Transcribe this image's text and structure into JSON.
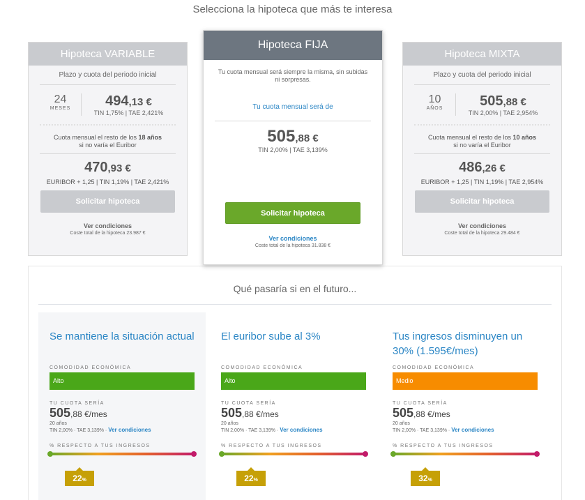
{
  "page": {
    "title": "Selecciona la hipoteca que más te interesa"
  },
  "cards": {
    "variable": {
      "title": "Hipoteca VARIABLE",
      "subtitle": "Plazo y cuota del periodo inicial",
      "months": "24",
      "months_unit": "MESES",
      "price_int": "494",
      "price_dec": ",13 €",
      "rates": "TIN 1,75% | TAE 2,421%",
      "note_pre": "Cuota mensual el resto de los",
      "note_years": "18 años",
      "note_post": "si no varía el Euribor",
      "price2_int": "470",
      "price2_dec": ",93 €",
      "rates2": "EURIBOR + 1,25 | TIN 1,19% | TAE 2,421%",
      "button": "Solicitar hipoteca",
      "conditions": "Ver condiciones",
      "cost": "Coste total de la hipoteca 23.987 €"
    },
    "fija": {
      "title": "Hipoteca FIJA",
      "description": "Tu cuota mensual será siempre la misma, sin subidas ni sorpresas.",
      "label": "Tu cuota mensual será de",
      "price_int": "505",
      "price_dec": ",88 €",
      "rates": "TIN 2,00% | TAE 3,139%",
      "button": "Solicitar hipoteca",
      "conditions": "Ver condiciones",
      "cost": "Coste total de la hipoteca 31.838 €"
    },
    "mixta": {
      "title": "Hipoteca MIXTA",
      "subtitle": "Plazo y cuota del periodo inicial",
      "months": "10",
      "months_unit": "AÑOS",
      "price_int": "505",
      "price_dec": ",88 €",
      "rates": "TIN 2,00% | TAE 2,954%",
      "note_pre": "Cuota mensual el resto de los",
      "note_years": "10 años",
      "note_post": "si no varía el Euribor",
      "price2_int": "486",
      "price2_dec": ",26 €",
      "rates2": "EURIBOR + 1,25 | TIN 1,19% | TAE 2,954%",
      "button": "Solicitar hipoteca",
      "conditions": "Ver condiciones",
      "cost": "Coste total de la hipoteca 29.484 €"
    }
  },
  "future": {
    "title": "Qué pasaría si en el futuro...",
    "label_comodidad": "COMODIDAD ECONÓMICA",
    "label_cuota": "TU CUOTA SERÍA",
    "label_respecto": "% RESPECTO A TUS INGRESOS",
    "scenarios": [
      {
        "title": "Se mantiene la situación actual",
        "level": "Alto",
        "level_color": "#4aa719",
        "cuota_int": "505",
        "cuota_dec": ",88 €/mes",
        "years": "20 años",
        "rates": "TIN 2,00% · TAE 3,139% ·",
        "link": "Ver condiciones",
        "pct": "22",
        "pct_sign": "%",
        "pct_value": 22
      },
      {
        "title": "El euribor sube al 3%",
        "level": "Alto",
        "level_color": "#4aa719",
        "cuota_int": "505",
        "cuota_dec": ",88 €/mes",
        "years": "20 años",
        "rates": "TIN 2,00% · TAE 3,139% ·",
        "link": "Ver condiciones",
        "pct": "22",
        "pct_sign": "%",
        "pct_value": 22
      },
      {
        "title": "Tus ingresos disminuyen un 30% (1.595€/mes)",
        "level": "Medio",
        "level_color": "#f78c00",
        "cuota_int": "505",
        "cuota_dec": ",88 €/mes",
        "years": "20 años",
        "rates": "TIN 2,00% · TAE 3,139% ·",
        "link": "Ver condiciones",
        "pct": "32",
        "pct_sign": "%",
        "pct_value": 32
      }
    ]
  }
}
